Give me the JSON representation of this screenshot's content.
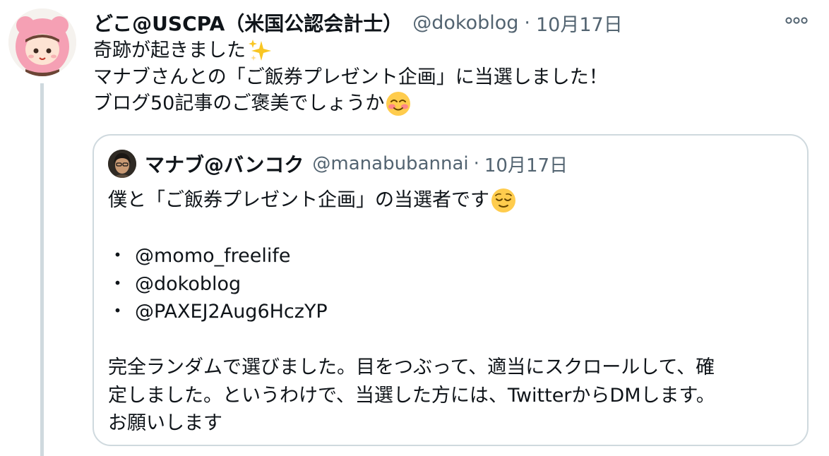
{
  "tweet": {
    "display_name": "どこ@USCPA（米国公認会計士）",
    "handle": "@dokoblog",
    "separator": "·",
    "date": "10月17日",
    "more_icon": "ellipsis-icon",
    "text_lines": [
      "奇跡が起きました",
      "マナブさんとの「ご飯券プレゼント企画」に当選しました！",
      "ブログ50記事のご褒美でしょうか"
    ],
    "emoji": [
      "sparkles-icon",
      "smiling-face-icon"
    ]
  },
  "quote": {
    "display_name": "マナブ@バンコク",
    "handle": "@manabubannai",
    "separator": "·",
    "date": "10月17日",
    "intro": "僕と「ご飯券プレゼント企画」の当選者です",
    "emoji": "relieved-face-icon",
    "bullet": "・",
    "mentions": [
      "@momo_freelife",
      "@dokoblog",
      "@PAXEJ2Aug6HczYP"
    ],
    "closing_lines": [
      "完全ランダムで選びました。目をつぶって、適当にスクロールして、確",
      "定しました。というわけで、当選した方には、TwitterからDMします。",
      "お願いします"
    ]
  },
  "colors": {
    "text": "#0f1419",
    "muted": "#536471",
    "border": "#cfd9de",
    "thread_line": "#cfd9de"
  }
}
